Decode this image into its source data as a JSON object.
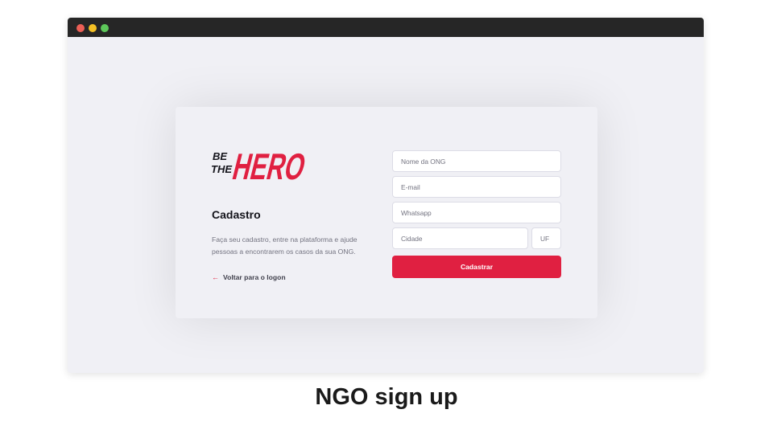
{
  "window": {
    "traffic_lights": [
      {
        "name": "close",
        "color": "#ec5f56"
      },
      {
        "name": "minimize",
        "color": "#f4c025"
      },
      {
        "name": "maximize",
        "color": "#5dc75a"
      }
    ]
  },
  "brand": {
    "logo_line1": "BE",
    "logo_line2": "THE",
    "logo_hero": "HERO",
    "accent_color": "#e02041"
  },
  "register": {
    "title": "Cadastro",
    "description": "Faça seu cadastro, entre na plataforma e ajude pessoas a encontrarem os casos da sua ONG.",
    "back_link": "Voltar para o logon",
    "back_icon": "arrow-left-icon"
  },
  "form": {
    "name_placeholder": "Nome da ONG",
    "email_placeholder": "E-mail",
    "whatsapp_placeholder": "Whatsapp",
    "city_placeholder": "Cidade",
    "uf_placeholder": "UF",
    "submit_label": "Cadastrar"
  },
  "caption": "NGO sign up"
}
